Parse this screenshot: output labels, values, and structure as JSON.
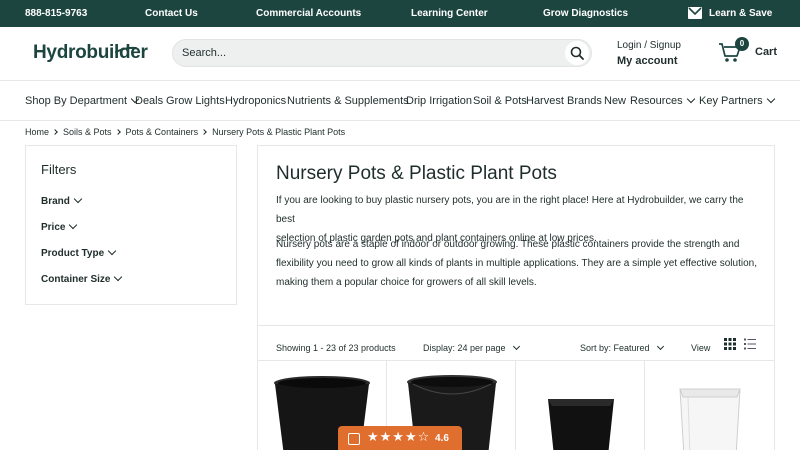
{
  "colors": {
    "brand": "#1d4540",
    "accent": "#e06f2f",
    "border": "#e6e8e8"
  },
  "topbar": {
    "phone": "888-815-9763",
    "links": [
      "Contact Us",
      "Commercial Accounts",
      "Learning Center",
      "Grow Diagnostics"
    ],
    "promo": "Learn & Save",
    "promo_icon": "mail-icon"
  },
  "header": {
    "logo": "Hydrobuilder",
    "search_placeholder": "Search...",
    "search_icon": "search-icon",
    "login_label": "Login / Signup",
    "account_label": "My account",
    "cart_count": "0",
    "cart_label": "Cart",
    "cart_icon": "cart-icon"
  },
  "nav": {
    "items": [
      {
        "label": "Shop By Department",
        "dropdown": true
      },
      {
        "label": "Deals",
        "dropdown": false
      },
      {
        "label": "Grow Lights",
        "dropdown": false
      },
      {
        "label": "Hydroponics",
        "dropdown": false
      },
      {
        "label": "Nutrients & Supplements",
        "dropdown": false
      },
      {
        "label": "Drip Irrigation",
        "dropdown": false
      },
      {
        "label": "Soil & Pots",
        "dropdown": false
      },
      {
        "label": "Harvest",
        "dropdown": false
      },
      {
        "label": "Brands",
        "dropdown": false
      },
      {
        "label": "New",
        "dropdown": false
      },
      {
        "label": "Resources",
        "dropdown": true
      },
      {
        "label": "Key Partners",
        "dropdown": true
      }
    ]
  },
  "breadcrumb": [
    "Home",
    "Soils & Pots",
    "Pots & Containers",
    "Nursery Pots & Plastic Plant Pots"
  ],
  "filters": {
    "title": "Filters",
    "items": [
      "Brand",
      "Price",
      "Product Type",
      "Container Size"
    ]
  },
  "main": {
    "title": "Nursery Pots & Plastic Plant Pots",
    "paragraphs": [
      [
        "If you are looking to buy plastic nursery pots, you are in the right place! Here at Hydrobuilder, we carry the best",
        "selection of plastic garden pots and plant containers online at low prices."
      ],
      [
        "Nursery pots are a staple of indoor or outdoor growing. These plastic containers provide the strength and",
        "flexibility you need to grow all kinds of plants in multiple applications. They are a simple yet effective solution,",
        "making them a popular choice for growers of all skill levels."
      ]
    ],
    "toolbar": {
      "showing": "Showing 1 - 23 of 23 products",
      "display": "Display: 24 per page",
      "sort": "Sort by: Featured",
      "view": "View",
      "grid_icon": "grid-view-icon",
      "list_icon": "list-view-icon"
    }
  },
  "rating": {
    "stars": "★★★★☆",
    "value": "4.6",
    "score": 4.6,
    "max": 5
  }
}
